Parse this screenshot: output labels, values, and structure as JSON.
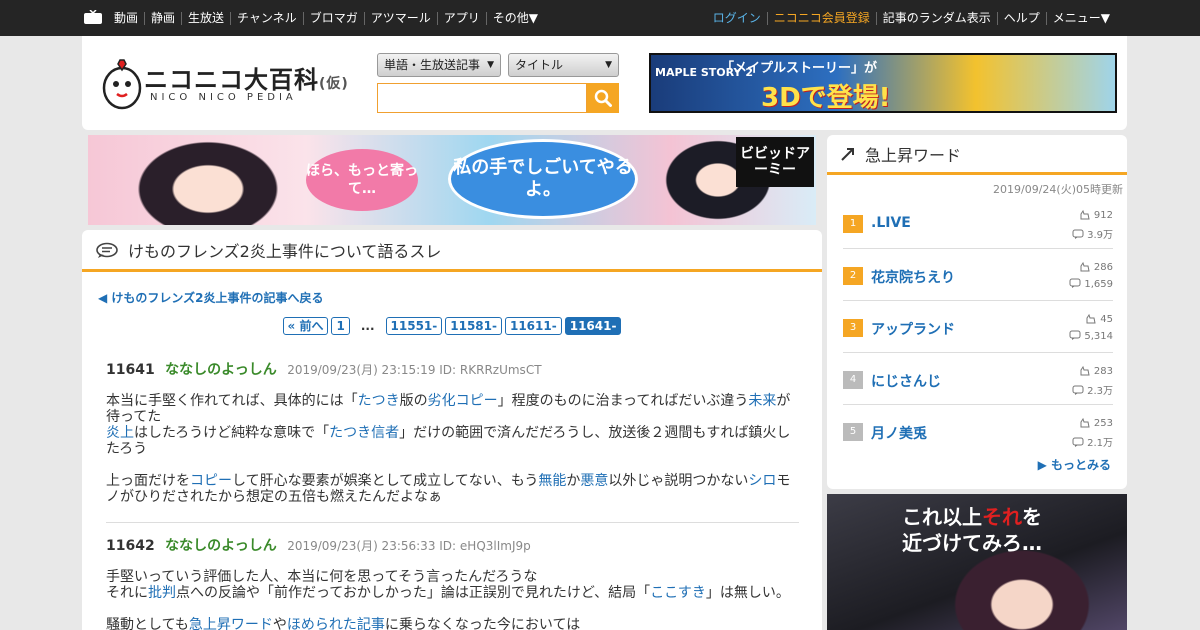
{
  "topnav": {
    "left": [
      "動画",
      "静画",
      "生放送",
      "チャンネル",
      "ブロマガ",
      "アツマール",
      "アプリ",
      "その他▼"
    ],
    "login": "ログイン",
    "register": "ニコニコ会員登録",
    "right": [
      "記事のランダム表示",
      "ヘルプ",
      "メニュー▼"
    ]
  },
  "header": {
    "logo_text": "ニコニコ大百科",
    "logo_suffix": "(仮)",
    "logo_sub": "NICO NICO PEDIA",
    "search_type": "単語・生放送記事",
    "search_scope": "タイトル",
    "search_value": "",
    "ad": {
      "brand": "MAPLE STORY 2",
      "line1": "「メイプルストーリー」が",
      "line2": "3Dで登場!"
    }
  },
  "banner": {
    "bubble1": "ほら、もっと寄って…",
    "bubble2": "私の手でしごいてやるよ。",
    "title": "ビビッドアーミー"
  },
  "thread": {
    "title": "けものフレンズ2炎上事件について語るスレ",
    "back_link": "◀ けものフレンズ2炎上事件の記事へ戻る",
    "pager": [
      "« 前へ",
      "1",
      "...",
      "11551-",
      "11581-",
      "11611-",
      "11641-"
    ],
    "posts": [
      {
        "num": "11641",
        "name": "ななしのよっしん",
        "date": "2019/09/23(月) 23:15:19 ID: RKRRzUmsCT",
        "l1a": "本当に手堅く作れてれば、具体的には「",
        "l1b": "たつき",
        "l1c": "版の",
        "l1d": "劣化コピー",
        "l1e": "」程度のものに治まってればだいぶ違う",
        "l1f": "未来",
        "l1g": "が待ってた",
        "l2a": "炎上",
        "l2b": "はしたろうけど純粋な意味で「",
        "l2c": "たつき信者",
        "l2d": "」だけの範囲で済んだだろうし、放送後２週間もすれば鎮火したろう",
        "l3a": "上っ面だけを",
        "l3b": "コピー",
        "l3c": "して肝心な要素が娯楽として成立してない、もう",
        "l3d": "無能",
        "l3e": "か",
        "l3f": "悪意",
        "l3g": "以外じゃ説明つかない",
        "l3h": "シロ",
        "l3i": "モノがひりだされたから想定の五倍も燃えたんだよなぁ"
      },
      {
        "num": "11642",
        "name": "ななしのよっしん",
        "date": "2019/09/23(月) 23:56:33 ID: eHQ3lImJ9p",
        "l1": "手堅いっていう評価した人、本当に何を思ってそう言ったんだろうな",
        "l2a": "それに",
        "l2b": "批判",
        "l2c": "点への反論や「前作だっておかしかった」論は正誤別で見れたけど、結局「",
        "l2d": "ここすき",
        "l2e": "」は無しい。",
        "l3a": "騒動としても",
        "l3b": "急上昇ワード",
        "l3c": "や",
        "l3d": "ほめられた記事",
        "l3e": "に乗らなくなった今においては"
      }
    ]
  },
  "trending": {
    "title": "急上昇ワード",
    "updated": "2019/09/24(火)05時更新",
    "items": [
      {
        "rank": "1",
        "word": ".LIVE",
        "count1": "912",
        "count2": "3.9万"
      },
      {
        "rank": "2",
        "word": "花京院ちえり",
        "count1": "286",
        "count2": "1,659"
      },
      {
        "rank": "3",
        "word": "アップランド",
        "count1": "45",
        "count2": "5,314"
      },
      {
        "rank": "4",
        "word": "にじさんじ",
        "count1": "283",
        "count2": "2.3万"
      },
      {
        "rank": "5",
        "word": "月ノ美兎",
        "count1": "253",
        "count2": "2.1万"
      }
    ],
    "more": "▶ もっとみる"
  },
  "side_ad": {
    "line1a": "これ以上",
    "line1b": "それ",
    "line1c": "を",
    "line2": "近づけてみろ…"
  },
  "colors": {
    "accent": "#f5a623",
    "link": "#1f6fb5",
    "name": "#3a8a2a",
    "rank_top": "#f5a623",
    "rank_other": "#bbbbbb"
  }
}
